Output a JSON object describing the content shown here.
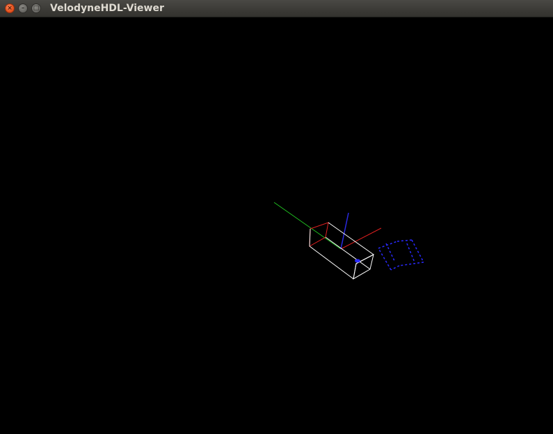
{
  "window": {
    "title": "VelodyneHDL-Viewer",
    "background_color": "#000000",
    "controls": {
      "close": {
        "glyph": "×",
        "icon": "close-icon",
        "color": "#e8551f"
      },
      "minimize": {
        "glyph": "–",
        "icon": "minimize-icon"
      },
      "maximize": {
        "glyph": "□",
        "icon": "maximize-icon"
      }
    }
  },
  "scene": {
    "axis_colors": {
      "x": "#e02020",
      "y": "#20c020",
      "z": "#2a2ae0"
    },
    "sensor_box_color": "#ffffff",
    "sensor_end_face_color": "#e02020",
    "point_cloud_color": "#2a2aff"
  }
}
